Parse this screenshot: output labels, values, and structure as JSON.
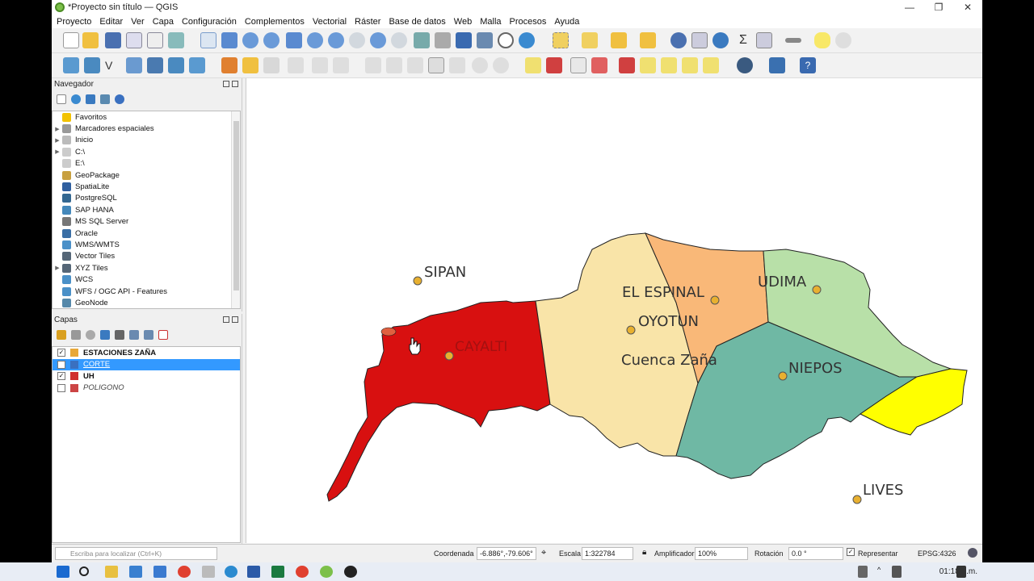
{
  "window": {
    "title": "*Proyecto sin título — QGIS",
    "controls": [
      "—",
      "❐",
      "✕"
    ]
  },
  "menu": [
    "Proyecto",
    "Editar",
    "Ver",
    "Capa",
    "Configuración",
    "Complementos",
    "Vectorial",
    "Ráster",
    "Base de datos",
    "Web",
    "Malla",
    "Procesos",
    "Ayuda"
  ],
  "browser_panel": {
    "title": "Navegador",
    "items": [
      {
        "label": "Favoritos",
        "icon": "star-icon",
        "color": "#f2c200",
        "expand": false
      },
      {
        "label": "Marcadores espaciales",
        "icon": "bookmark-icon",
        "color": "#999999",
        "expand": true
      },
      {
        "label": "Inicio",
        "icon": "home-icon",
        "color": "#bbbbbb",
        "expand": true
      },
      {
        "label": "C:\\",
        "icon": "drive-icon",
        "color": "#cccccc",
        "expand": true
      },
      {
        "label": "E:\\",
        "icon": "drive-icon",
        "color": "#cccccc",
        "expand": false
      },
      {
        "label": "GeoPackage",
        "icon": "geopackage-icon",
        "color": "#c8a040",
        "expand": false
      },
      {
        "label": "SpatiaLite",
        "icon": "spatialite-icon",
        "color": "#2f5f9f",
        "expand": false
      },
      {
        "label": "PostgreSQL",
        "icon": "postgresql-icon",
        "color": "#336791",
        "expand": false
      },
      {
        "label": "SAP HANA",
        "icon": "sap-hana-icon",
        "color": "#4488bb",
        "expand": false
      },
      {
        "label": "MS SQL Server",
        "icon": "mssql-icon",
        "color": "#777777",
        "expand": false
      },
      {
        "label": "Oracle",
        "icon": "oracle-icon",
        "color": "#3a6ea5",
        "expand": false
      },
      {
        "label": "WMS/WMTS",
        "icon": "globe-icon",
        "color": "#4a90c8",
        "expand": false
      },
      {
        "label": "Vector Tiles",
        "icon": "vector-tiles-icon",
        "color": "#556677",
        "expand": false
      },
      {
        "label": "XYZ Tiles",
        "icon": "xyz-tiles-icon",
        "color": "#556677",
        "expand": true
      },
      {
        "label": "WCS",
        "icon": "globe-icon",
        "color": "#4a90c8",
        "expand": false
      },
      {
        "label": "WFS / OGC API - Features",
        "icon": "globe-icon",
        "color": "#4a90c8",
        "expand": false
      },
      {
        "label": "GeoNode",
        "icon": "geonode-icon",
        "color": "#5588aa",
        "expand": false
      }
    ]
  },
  "layers_panel": {
    "title": "Capas",
    "layers": [
      {
        "label": "ESTACIONES ZAÑA",
        "checked": true,
        "bold": true,
        "italic": false,
        "selected": false,
        "icon_color": "#e8a838"
      },
      {
        "label": "CORTE",
        "checked": true,
        "bold": false,
        "italic": false,
        "selected": true,
        "icon_color": "#3a70c0"
      },
      {
        "label": "UH",
        "checked": true,
        "bold": true,
        "italic": false,
        "selected": false,
        "icon_color": "#d03030"
      },
      {
        "label": "POLIGONO",
        "checked": false,
        "bold": false,
        "italic": true,
        "selected": false,
        "icon_color": "#cc4444"
      }
    ]
  },
  "map_labels": [
    "SIPAN",
    "CAYALTI",
    "EL ESPINAL",
    "OYOTUN",
    "Cuenca Zaña",
    "UDIMA",
    "NIEPOS",
    "LIVES"
  ],
  "status": {
    "locator_placeholder": "Escriba para localizar (Ctrl+K)",
    "coord_label": "Coordenada",
    "coord_value": "-6.886°,-79.606°",
    "scale_label": "Escala",
    "scale_value": "1:322784",
    "magnifier_label": "Amplificador",
    "magnifier_value": "100%",
    "rotation_label": "Rotación",
    "rotation_value": "0.0 °",
    "render_label": "Representar",
    "crs": "EPSG:4326"
  },
  "taskbar": {
    "time": "01:18 p.m."
  },
  "colors": {
    "cayalti": "#d81010",
    "oyotun": "#f9e4a8",
    "el_espinal": "#f9b878",
    "udima": "#b8e0a8",
    "niepos": "#6fb8a4",
    "yellow_tip": "#ffff00",
    "station": "#e8b030",
    "selection": "#3399ff"
  }
}
